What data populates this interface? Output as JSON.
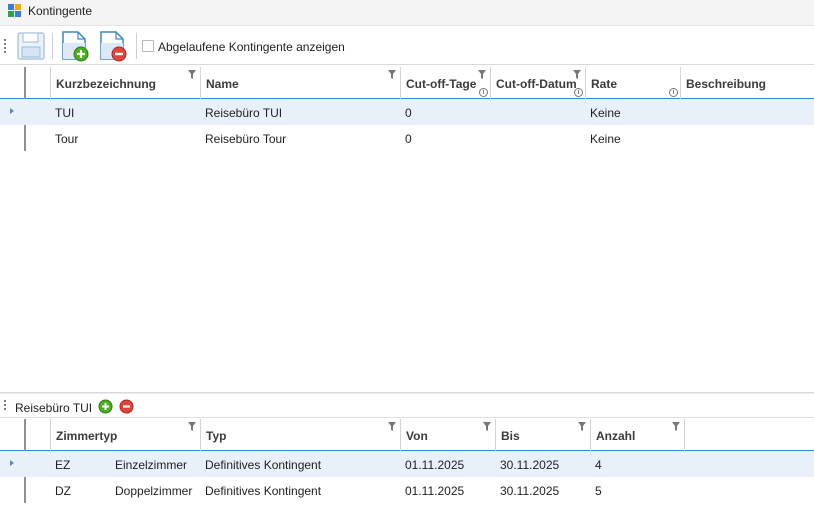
{
  "window": {
    "title": "Kontingente"
  },
  "toolbar": {
    "save_icon": "save-icon",
    "add_icon": "add-document-icon",
    "remove_icon": "remove-document-icon",
    "show_expired_label": "Abgelaufene Kontingente anzeigen",
    "show_expired_checked": false
  },
  "main_grid": {
    "columns": [
      "Kurzbezeichnung",
      "Name",
      "Cut-off-Tage",
      "Cut-off-Datum",
      "Rate",
      "Beschreibung"
    ],
    "rows": [
      {
        "kurz": "TUI",
        "name": "Reisebüro TUI",
        "cutoff_tage": "0",
        "cutoff_datum": "",
        "rate": "Keine",
        "beschreibung": ""
      },
      {
        "kurz": "Tour",
        "name": "Reisebüro Tour",
        "cutoff_tage": "0",
        "cutoff_datum": "",
        "rate": "Keine",
        "beschreibung": ""
      }
    ]
  },
  "detail": {
    "title": "Reisebüro TUI",
    "columns": [
      "Zimmertyp",
      "Typ",
      "Von",
      "Bis",
      "Anzahl"
    ],
    "rows": [
      {
        "code": "EZ",
        "zimmertyp": "Einzelzimmer",
        "typ": "Definitives Kontingent",
        "von": "01.11.2025",
        "bis": "30.11.2025",
        "anzahl": "4"
      },
      {
        "code": "DZ",
        "zimmertyp": "Doppelzimmer",
        "typ": "Definitives Kontingent",
        "von": "01.11.2025",
        "bis": "30.11.2025",
        "anzahl": "5"
      }
    ]
  },
  "colors": {
    "accent": "#2c8ad2",
    "selected_row": "#e8f1fa",
    "add": "#4caf22",
    "remove": "#e0443a"
  }
}
